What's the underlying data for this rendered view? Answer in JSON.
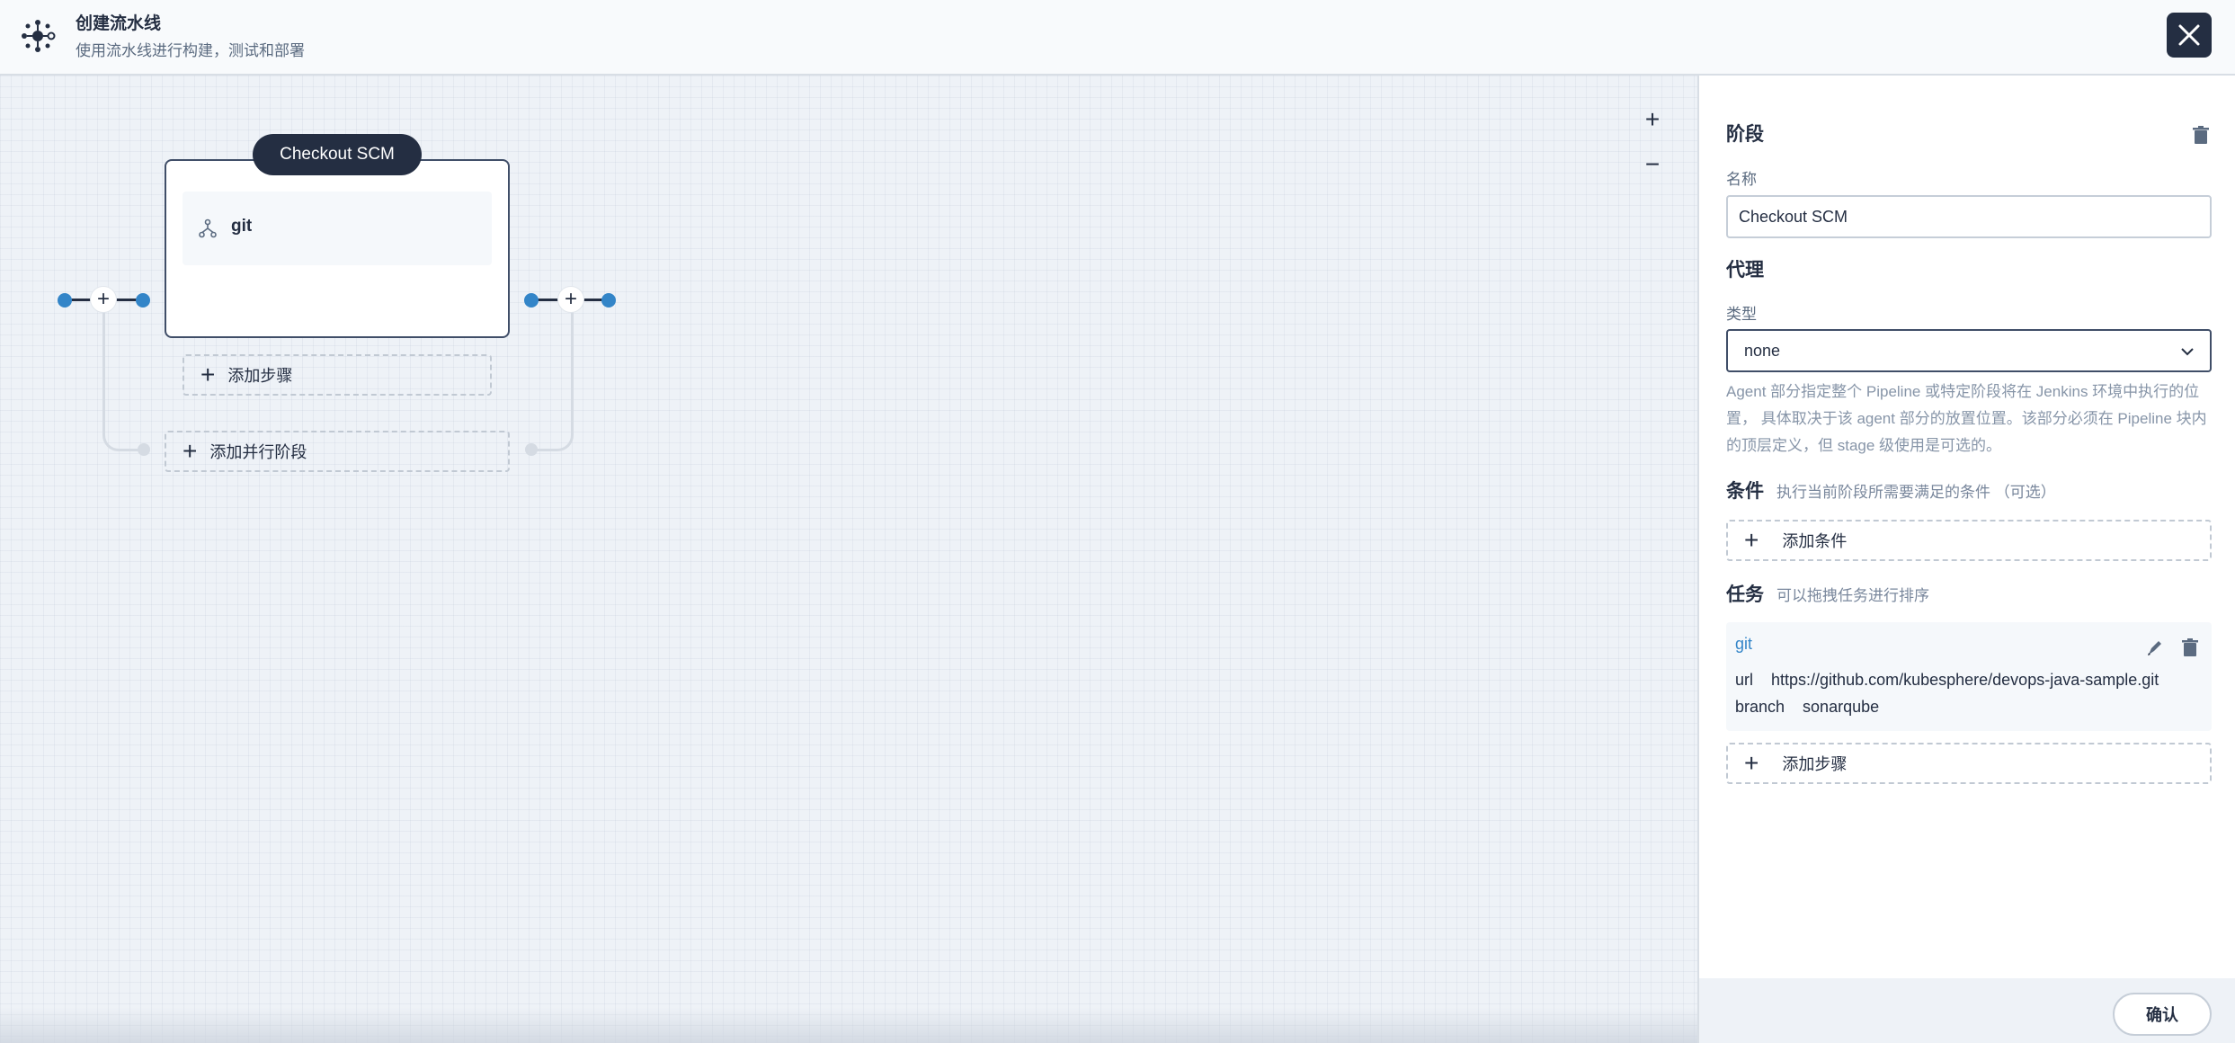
{
  "header": {
    "title": "创建流水线",
    "subtitle": "使用流水线进行构建，测试和部署",
    "logo_icon": "pipeline-icon",
    "close_icon": "close-icon"
  },
  "canvas": {
    "zoom_in": "+",
    "zoom_out": "−",
    "stage": {
      "name": "Checkout SCM",
      "steps": [
        {
          "name": "git",
          "icon": "git-branch-icon"
        }
      ],
      "add_step_label": "添加步骤"
    },
    "add_parallel_stage_label": "添加并行阶段"
  },
  "panel": {
    "stage_title": "阶段",
    "name_label": "名称",
    "name_value": "Checkout SCM",
    "agent_title": "代理",
    "type_label": "类型",
    "type_value": "none",
    "agent_description": "Agent 部分指定整个 Pipeline 或特定阶段将在 Jenkins 环境中执行的位置， 具体取决于该 agent 部分的放置位置。该部分必须在 Pipeline 块内的顶层定义，但 stage 级使用是可选的。",
    "condition_title": "条件",
    "condition_hint": "执行当前阶段所需要满足的条件 （可选）",
    "add_condition_label": "添加条件",
    "task_title": "任务",
    "task_hint": "可以拖拽任务进行排序",
    "tasks": [
      {
        "name": "git",
        "params": [
          {
            "key": "url",
            "value": "https://github.com/kubesphere/devops-java-sample.git"
          },
          {
            "key": "branch",
            "value": "sonarqube"
          }
        ]
      }
    ],
    "add_step_label": "添加步骤",
    "confirm_label": "确认"
  },
  "colors": {
    "dark": "#242e42",
    "accent_blue": "#3385c8",
    "canvas_bg": "#eef2f7"
  }
}
